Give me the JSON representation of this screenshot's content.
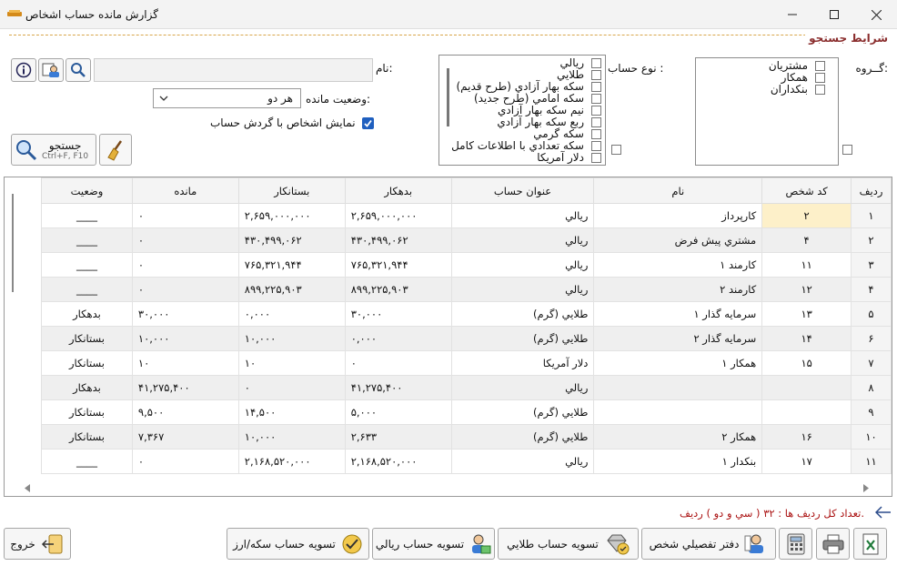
{
  "window": {
    "title": "گزارش مانده حساب اشخاص"
  },
  "section_title": "شرايط جستجو",
  "search": {
    "name_label": "نام:",
    "name_value": "",
    "balance_status_label": "وضعيت مانده:",
    "balance_status_value": "هر دو",
    "show_turnover_label": "نمايش اشخاص با گردش حساب",
    "search_button": "جستجو",
    "search_shortcut": "Ctrl+F, F10"
  },
  "account_type": {
    "label": "نوع حساب :",
    "items": [
      "ريالي",
      "طلايي",
      "سكه بهار آزادي (طرح قديم)",
      "سكه امامي (طرح جديد)",
      "نيم سكه بهار آزادي",
      "ربع سكه بهار آزادي",
      "سكه گرمي",
      "سكه تعدادي با اطلاعات كامل",
      "دلار آمريكا"
    ]
  },
  "group": {
    "label": "گــروه:",
    "items": [
      "مشتريان",
      "همكار",
      "بنكداران"
    ]
  },
  "table": {
    "headers": [
      "رديف",
      "كد شخص",
      "نام",
      "عنوان حساب",
      "بدهكار",
      "بستانكار",
      "مانده",
      "وضعيت"
    ],
    "rows": [
      {
        "idx": "۱",
        "code": "۲",
        "name": "كارپرداز",
        "account": "ريالي",
        "debit": "۲,۶۵۹,۰۰۰,۰۰۰",
        "credit": "۲,۶۵۹,۰۰۰,۰۰۰",
        "balance": "۰",
        "status": "____"
      },
      {
        "idx": "۲",
        "code": "۴",
        "name": "مشتري پيش فرض",
        "account": "ريالي",
        "debit": "۴۳۰,۴۹۹,۰۶۲",
        "credit": "۴۳۰,۴۹۹,۰۶۲",
        "balance": "۰",
        "status": "____"
      },
      {
        "idx": "۳",
        "code": "۱۱",
        "name": "كارمند ۱",
        "account": "ريالي",
        "debit": "۷۶۵,۳۲۱,۹۴۴",
        "credit": "۷۶۵,۳۲۱,۹۴۴",
        "balance": "۰",
        "status": "____"
      },
      {
        "idx": "۴",
        "code": "۱۲",
        "name": "كارمند ۲",
        "account": "ريالي",
        "debit": "۸۹۹,۲۲۵,۹۰۳",
        "credit": "۸۹۹,۲۲۵,۹۰۳",
        "balance": "۰",
        "status": "____"
      },
      {
        "idx": "۵",
        "code": "۱۳",
        "name": "سرمايه گذار ۱",
        "account": "طلايي (گرم)",
        "debit": "۳۰,۰۰۰",
        "credit": "۰,۰۰۰",
        "balance": "۳۰,۰۰۰",
        "status": "بدهكار"
      },
      {
        "idx": "۶",
        "code": "۱۴",
        "name": "سرمايه گذار ۲",
        "account": "طلايي (گرم)",
        "debit": "۰,۰۰۰",
        "credit": "۱۰,۰۰۰",
        "balance": "۱۰,۰۰۰",
        "status": "بستانكار"
      },
      {
        "idx": "۷",
        "code": "۱۵",
        "name": "همكار ۱",
        "account": "دلار آمريكا",
        "debit": "۰",
        "credit": "۱۰",
        "balance": "۱۰",
        "status": "بستانكار"
      },
      {
        "idx": "۸",
        "code": "",
        "name": "",
        "account": "ريالي",
        "debit": "۴۱,۲۷۵,۴۰۰",
        "credit": "۰",
        "balance": "۴۱,۲۷۵,۴۰۰",
        "status": "بدهكار"
      },
      {
        "idx": "۹",
        "code": "",
        "name": "",
        "account": "طلايي (گرم)",
        "debit": "۵,۰۰۰",
        "credit": "۱۴,۵۰۰",
        "balance": "۹,۵۰۰",
        "status": "بستانكار"
      },
      {
        "idx": "۱۰",
        "code": "۱۶",
        "name": "همكار ۲",
        "account": "طلايي (گرم)",
        "debit": "۲,۶۳۳",
        "credit": "۱۰,۰۰۰",
        "balance": "۷,۳۶۷",
        "status": "بستانكار"
      },
      {
        "idx": "۱۱",
        "code": "۱۷",
        "name": "بنكدار ۱",
        "account": "ريالي",
        "debit": "۲,۱۶۸,۵۲۰,۰۰۰",
        "credit": "۲,۱۶۸,۵۲۰,۰۰۰",
        "balance": "۰",
        "status": "____"
      }
    ]
  },
  "footer": {
    "status_text": "تعداد كل رديف ها : ۳۲ ( سي و دو ) رديف.",
    "exit": "خروج",
    "btn_coin": "تسويه حساب سكه/ارز",
    "btn_rial": "تسويه حساب ريالي",
    "btn_gold": "تسويه حساب طلايي",
    "btn_ledger": "دفتر تفصيلي شخص"
  }
}
